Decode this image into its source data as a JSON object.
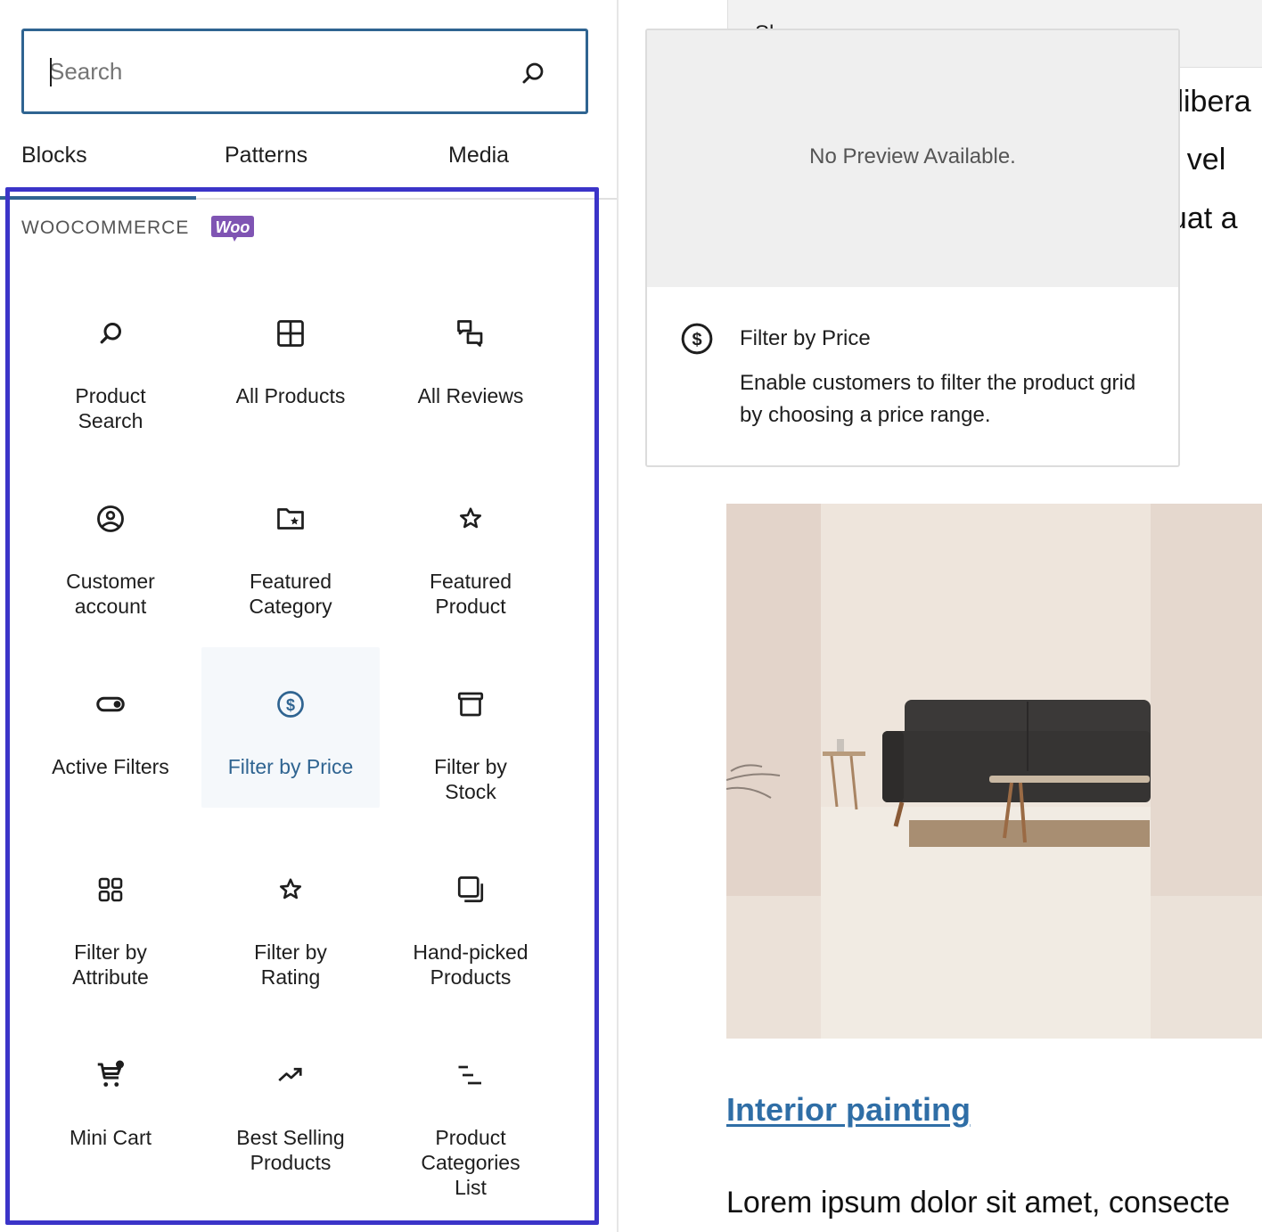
{
  "inserter": {
    "search": {
      "placeholder": "Search",
      "value": ""
    },
    "tabs": [
      {
        "label": "Blocks",
        "active": true
      },
      {
        "label": "Patterns",
        "active": false
      },
      {
        "label": "Media",
        "active": false
      }
    ],
    "category": {
      "title": "WOOCOMMERCE",
      "logo_text": "Woo",
      "logo_color": "#7f54b3"
    },
    "blocks": [
      {
        "label": "Product\nSearch",
        "icon": "search-icon"
      },
      {
        "label": "All Products",
        "icon": "grid-icon"
      },
      {
        "label": "All Reviews",
        "icon": "comments-icon"
      },
      {
        "label": "Customer\naccount",
        "icon": "user-circle-icon"
      },
      {
        "label": "Featured\nCategory",
        "icon": "folder-star-icon"
      },
      {
        "label": "Featured\nProduct",
        "icon": "star-icon"
      },
      {
        "label": "Active Filters",
        "icon": "toggle-icon"
      },
      {
        "label": "Filter by Price",
        "icon": "dollar-circle-icon",
        "selected": true
      },
      {
        "label": "Filter by\nStock",
        "icon": "box-icon"
      },
      {
        "label": "Filter by\nAttribute",
        "icon": "category-grid-icon"
      },
      {
        "label": "Filter by\nRating",
        "icon": "star-icon"
      },
      {
        "label": "Hand-picked\nProducts",
        "icon": "copy-icon"
      },
      {
        "label": "Mini Cart",
        "icon": "cart-icon"
      },
      {
        "label": "Best Selling\nProducts",
        "icon": "trending-up-icon"
      },
      {
        "label": "Product\nCategories\nList",
        "icon": "list-indent-icon"
      }
    ]
  },
  "preview": {
    "empty_text": "No Preview Available.",
    "title": "Filter by Price",
    "description": "Enable customers to filter the product grid by choosing a price range."
  },
  "editor": {
    "behind_box_text": "Sh…",
    "behind_lines": [
      "s libera",
      "nt vel",
      "quat a"
    ],
    "post_title": "Interior painting",
    "post_excerpt": "Lorem ipsum dolor sit amet, consecte"
  },
  "colors": {
    "accent": "#2f6491",
    "highlight_frame": "#3b34c8",
    "link": "#2f6ea6",
    "woo_purple": "#7f54b3"
  }
}
